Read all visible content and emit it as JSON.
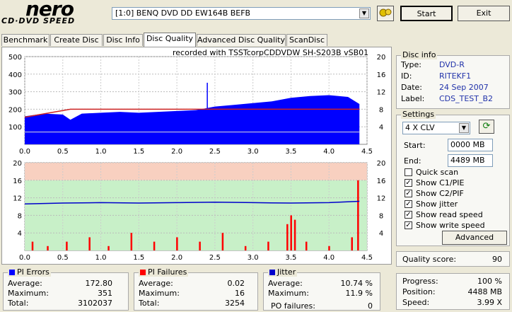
{
  "header": {
    "logo_main": "nero",
    "logo_sub": "CD·DVD SPEED",
    "drive": "[1:0]  BENQ DVD DD EW164B BEFB",
    "start_label": "Start",
    "exit_label": "Exit"
  },
  "tabs": [
    "Benchmark",
    "Create Disc",
    "Disc Info",
    "Disc Quality",
    "Advanced Disc Quality",
    "ScanDisc"
  ],
  "active_tab": "Disc Quality",
  "chart_caption": "recorded with TSSTcorpCDDVDW SH-S203B  vSB01",
  "disc_info": {
    "title": "Disc info",
    "type_label": "Type:",
    "type_value": "DVD-R",
    "id_label": "ID:",
    "id_value": "RITEKF1",
    "date_label": "Date:",
    "date_value": "24 Sep 2007",
    "label_label": "Label:",
    "label_value": "CDS_TEST_B2"
  },
  "settings": {
    "title": "Settings",
    "speed": "4 X CLV",
    "start_label": "Start:",
    "start_value": "0000 MB",
    "end_label": "End:",
    "end_value": "4489 MB",
    "checks": [
      {
        "label": "Quick scan",
        "checked": false
      },
      {
        "label": "Show C1/PIE",
        "checked": true
      },
      {
        "label": "Show C2/PIF",
        "checked": true
      },
      {
        "label": "Show jitter",
        "checked": true
      },
      {
        "label": "Show read speed",
        "checked": true
      },
      {
        "label": "Show write speed",
        "checked": true
      }
    ],
    "advanced_label": "Advanced"
  },
  "quality": {
    "label": "Quality score:",
    "value": "90"
  },
  "progress": {
    "progress_label": "Progress:",
    "progress_value": "100 %",
    "position_label": "Position:",
    "position_value": "4488 MB",
    "speed_label": "Speed:",
    "speed_value": "3.99 X"
  },
  "pi_errors": {
    "title": "PI Errors",
    "avg_label": "Average:",
    "avg_value": "172.80",
    "max_label": "Maximum:",
    "max_value": "351",
    "total_label": "Total:",
    "total_value": "3102037"
  },
  "pi_failures": {
    "title": "PI Failures",
    "avg_label": "Average:",
    "avg_value": "0.02",
    "max_label": "Maximum:",
    "max_value": "16",
    "total_label": "Total:",
    "total_value": "3254"
  },
  "jitter": {
    "title": "Jitter",
    "avg_label": "Average:",
    "avg_value": "10.74 %",
    "max_label": "Maximum:",
    "max_value": "11.9 %",
    "po_label": "PO failures:",
    "po_value": "0"
  },
  "colors": {
    "pie": "#0000ff",
    "pif": "#ff0000",
    "jitter": "#0000cc",
    "speed_line": "#cc2222",
    "green_band": "#c8f0c8",
    "red_band": "#f8d0c0"
  },
  "chart_data": [
    {
      "type": "area",
      "x_ticks": [
        "0.0",
        "0.5",
        "1.0",
        "1.5",
        "2.0",
        "2.5",
        "3.0",
        "3.5",
        "4.0",
        "4.5"
      ],
      "y_left_ticks": [
        "500",
        "400",
        "300",
        "200",
        "100"
      ],
      "y_right_ticks": [
        "20",
        "16",
        "12",
        "8",
        "4"
      ],
      "xlim": [
        0,
        4.5
      ],
      "ylim": [
        0,
        500
      ],
      "series": [
        {
          "values_x": [
            0,
            0.25,
            0.5,
            0.6,
            0.75,
            1.0,
            1.25,
            1.5,
            1.75,
            2.0,
            2.25,
            2.5,
            2.75,
            3.0,
            3.25,
            3.5,
            3.75,
            4.0,
            4.25,
            4.4
          ],
          "values_y": [
            160,
            175,
            170,
            140,
            175,
            180,
            185,
            180,
            185,
            190,
            195,
            215,
            225,
            235,
            245,
            265,
            275,
            280,
            270,
            230
          ]
        },
        {
          "values_x": [
            0,
            0.1,
            0.6,
            1.0,
            1.5,
            2.0,
            2.5,
            3.0,
            3.5,
            4.0,
            4.4
          ],
          "values_y": [
            6.2,
            6.5,
            8,
            8,
            8,
            8,
            8,
            8,
            8,
            8,
            8
          ]
        }
      ]
    },
    {
      "type": "bar",
      "x_ticks": [
        "0.0",
        "0.5",
        "1.0",
        "1.5",
        "2.0",
        "2.5",
        "3.0",
        "3.5",
        "4.0",
        "4.5"
      ],
      "y_left_ticks": [
        "20",
        "16",
        "12",
        "8",
        "4"
      ],
      "y_right_ticks": [
        "20",
        "16",
        "12",
        "8",
        "4"
      ],
      "xlim": [
        0,
        4.5
      ],
      "ylim": [
        0,
        20
      ],
      "series": [
        {
          "values_x": [
            0.1,
            0.3,
            0.55,
            0.85,
            1.1,
            1.4,
            1.7,
            2.0,
            2.3,
            2.6,
            2.9,
            3.2,
            3.45,
            3.5,
            3.55,
            3.7,
            4.0,
            4.3,
            4.38
          ],
          "values_y": [
            2,
            1,
            2,
            3,
            1,
            4,
            2,
            3,
            2,
            4,
            1,
            2,
            6,
            8,
            7,
            2,
            1,
            3,
            16
          ]
        },
        {
          "values_x": [
            0,
            0.5,
            1.0,
            1.5,
            2.0,
            2.5,
            3.0,
            3.5,
            4.0,
            4.4
          ],
          "values_y": [
            10.6,
            10.8,
            10.9,
            10.8,
            10.9,
            11.0,
            10.9,
            10.8,
            10.9,
            11.2
          ]
        }
      ]
    }
  ]
}
